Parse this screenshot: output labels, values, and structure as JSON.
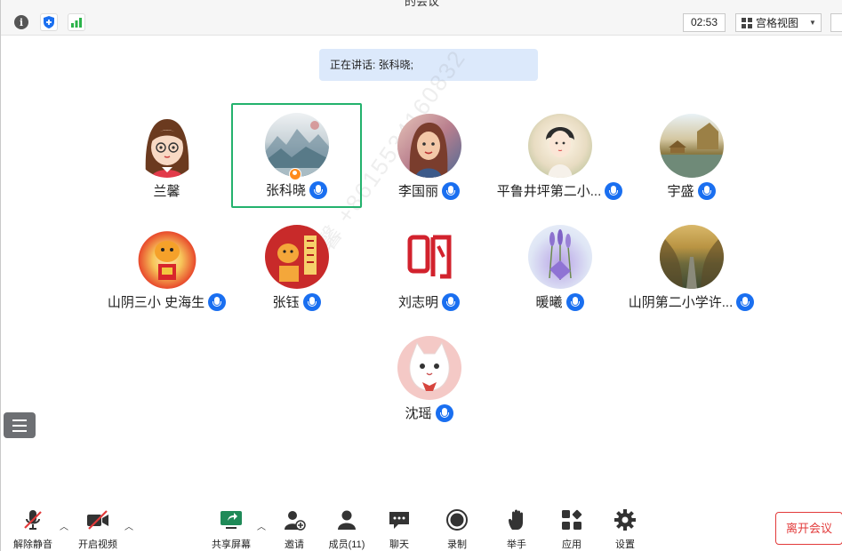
{
  "window": {
    "title": "的会议"
  },
  "topbar": {
    "timer": "02:53",
    "view_label": "宫格视图"
  },
  "speaking": {
    "text": "正在讲话: 张科晓;"
  },
  "participants": [
    {
      "name": "兰馨",
      "avatar": "girl-cartoon-avatar",
      "mic": false,
      "active": false
    },
    {
      "name": "张科晓",
      "avatar": "landscape-painting-avatar",
      "mic": true,
      "active": true,
      "host": true
    },
    {
      "name": "李国丽",
      "avatar": "woman-illustration-avatar",
      "mic": true,
      "active": false
    },
    {
      "name": "平鲁井坪第二小...",
      "avatar": "ancient-lady-avatar",
      "mic": true,
      "active": false
    },
    {
      "name": "宇盛",
      "avatar": "pavilion-lake-avatar",
      "mic": true,
      "active": false
    },
    {
      "name": "山阴三小 史海生",
      "avatar": "tiger-new-year-avatar",
      "mic": true,
      "active": false
    },
    {
      "name": "张钰",
      "avatar": "tiger-calligraphy-avatar",
      "mic": true,
      "active": false
    },
    {
      "name": "刘志明",
      "avatar": "red-seal-avatar",
      "mic": true,
      "active": false
    },
    {
      "name": "暖曦",
      "avatar": "lavender-flower-avatar",
      "mic": true,
      "active": false
    },
    {
      "name": "山阴第二小学许...",
      "avatar": "autumn-road-avatar",
      "mic": true,
      "active": false
    },
    {
      "name": "沈瑶",
      "avatar": "white-cat-avatar",
      "mic": true,
      "active": false
    }
  ],
  "watermark": {
    "text": "兰馨 +8615534160832"
  },
  "toolbar": {
    "unmute": "解除静音",
    "start_video": "开启视频",
    "share_screen": "共享屏幕",
    "invite": "邀请",
    "members": "成员(11)",
    "chat": "聊天",
    "record": "录制",
    "raise_hand": "举手",
    "apps": "应用",
    "settings": "设置",
    "leave": "离开会议"
  },
  "colors": {
    "accent": "#1a6ff0",
    "active_border": "#23b26d",
    "leave": "#e23a3a",
    "host": "#ff8a1c"
  }
}
